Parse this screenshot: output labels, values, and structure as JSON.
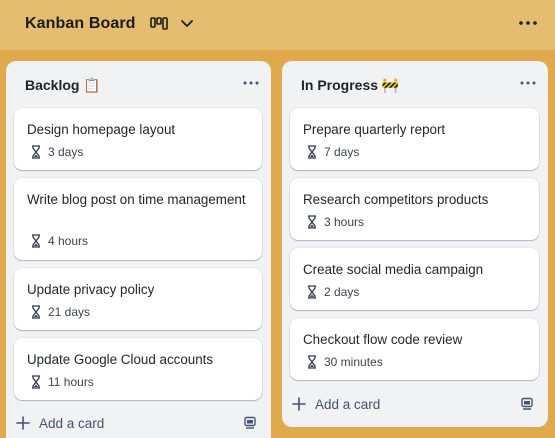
{
  "header": {
    "title": "Kanban Board",
    "view_icon": "board-view-icon",
    "dropdown_icon": "chevron-down-icon",
    "more_icon": "more-horizontal-icon"
  },
  "columns": [
    {
      "title": "Backlog 📋",
      "more_icon": "more-horizontal-icon",
      "cards": [
        {
          "title": "Design homepage layout",
          "duration": "3 days"
        },
        {
          "title": "Write blog post on time management",
          "duration": "4 hours"
        },
        {
          "title": "Update privacy policy",
          "duration": "21 days"
        },
        {
          "title": "Update Google Cloud accounts",
          "duration": "11 hours"
        }
      ],
      "add_label": "Add a card"
    },
    {
      "title": "In Progress 🚧",
      "more_icon": "more-horizontal-icon",
      "cards": [
        {
          "title": "Prepare quarterly report",
          "duration": "7 days"
        },
        {
          "title": "Research competitors products",
          "duration": "3 hours"
        },
        {
          "title": "Create social media campaign",
          "duration": "2 days"
        },
        {
          "title": "Checkout flow code review",
          "duration": "30 minutes"
        }
      ],
      "add_label": "Add a card"
    }
  ],
  "colors": {
    "board_background": "#e0a94b",
    "header_background": "#e4bd70",
    "column_background": "#f1f2f4",
    "card_background": "#ffffff"
  }
}
